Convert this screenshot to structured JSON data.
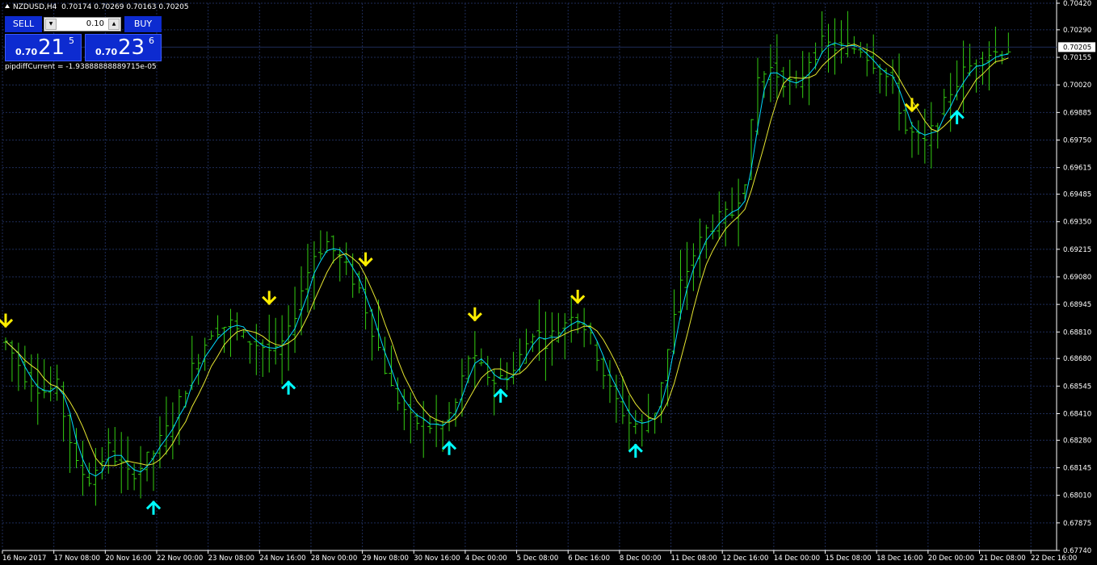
{
  "header": {
    "symbol": "NZDUSD,H4",
    "ohlc": "0.70174 0.70269 0.70163 0.70205"
  },
  "trade_panel": {
    "sell_label": "SELL",
    "buy_label": "BUY",
    "lot_value": "0.10",
    "sell_prefix": "0.70",
    "sell_big": "21",
    "sell_sup": "5",
    "buy_prefix": "0.70",
    "buy_big": "23",
    "buy_sup": "6"
  },
  "indicator_text": "pipdiffCurrent = -1.93888888889715e-05",
  "colors": {
    "background": "#000000",
    "grid": "#1e2c58",
    "bars": "#33cc11",
    "ma_fast": "#00d8ff",
    "ma_slow": "#e8e830",
    "arrow_up": "#00ffff",
    "arrow_down": "#ffee00",
    "price_tag_bg": "#ffffff",
    "button_blue": "#0d2bd0"
  },
  "chart_data": {
    "type": "line",
    "timeframe": "H4",
    "price_axis": {
      "ticks": [
        "0.70420",
        "0.70290",
        "0.70155",
        "0.70020",
        "0.69885",
        "0.69750",
        "0.69615",
        "0.69485",
        "0.69350",
        "0.69215",
        "0.69080",
        "0.68945",
        "0.68810",
        "0.68680",
        "0.68545",
        "0.68410",
        "0.68280",
        "0.68145",
        "0.68010",
        "0.67875",
        "0.67740"
      ],
      "range": [
        0.6774,
        0.7042
      ],
      "current_price": "0.70205"
    },
    "time_axis": {
      "ticks": [
        "16 Nov 2017",
        "17 Nov 08:00",
        "20 Nov 16:00",
        "22 Nov 00:00",
        "23 Nov 08:00",
        "24 Nov 16:00",
        "28 Nov 00:00",
        "29 Nov 08:00",
        "30 Nov 16:00",
        "4 Dec 00:00",
        "5 Dec 08:00",
        "6 Dec 16:00",
        "8 Dec 00:00",
        "11 Dec 08:00",
        "12 Dec 16:00",
        "14 Dec 00:00",
        "15 Dec 08:00",
        "18 Dec 16:00",
        "20 Dec 00:00",
        "21 Dec 08:00",
        "22 Dec 16:00"
      ]
    },
    "bars_per_tick": 8,
    "close_path": [
      [
        0,
        0.6876
      ],
      [
        3,
        0.686
      ],
      [
        6,
        0.6852
      ],
      [
        8,
        0.6854
      ],
      [
        11,
        0.6815
      ],
      [
        13,
        0.6809
      ],
      [
        16,
        0.6824
      ],
      [
        19,
        0.6811
      ],
      [
        21,
        0.6815
      ],
      [
        23,
        0.6822
      ],
      [
        26,
        0.6838
      ],
      [
        29,
        0.6863
      ],
      [
        32,
        0.6882
      ],
      [
        35,
        0.6885
      ],
      [
        37,
        0.6878
      ],
      [
        40,
        0.6874
      ],
      [
        42,
        0.687
      ],
      [
        44,
        0.688
      ],
      [
        46,
        0.6902
      ],
      [
        48,
        0.6919
      ],
      [
        50,
        0.6925
      ],
      [
        53,
        0.6912
      ],
      [
        55,
        0.6902
      ],
      [
        58,
        0.6873
      ],
      [
        60,
        0.6853
      ],
      [
        63,
        0.6838
      ],
      [
        66,
        0.6835
      ],
      [
        68,
        0.6835
      ],
      [
        70,
        0.6846
      ],
      [
        72,
        0.6869
      ],
      [
        74,
        0.6863
      ],
      [
        76,
        0.6857
      ],
      [
        79,
        0.6862
      ],
      [
        82,
        0.6882
      ],
      [
        84,
        0.6877
      ],
      [
        86,
        0.6882
      ],
      [
        88,
        0.6891
      ],
      [
        90,
        0.6884
      ],
      [
        92,
        0.687
      ],
      [
        94,
        0.6852
      ],
      [
        97,
        0.6837
      ],
      [
        99,
        0.6835
      ],
      [
        101,
        0.6843
      ],
      [
        103,
        0.6872
      ],
      [
        105,
        0.6904
      ],
      [
        107,
        0.6919
      ],
      [
        109,
        0.6931
      ],
      [
        111,
        0.6936
      ],
      [
        113,
        0.6939
      ],
      [
        115,
        0.6957
      ],
      [
        117,
        0.7005
      ],
      [
        119,
        0.701
      ],
      [
        121,
        0.7005
      ],
      [
        123,
        0.7
      ],
      [
        125,
        0.7015
      ],
      [
        127,
        0.7022
      ],
      [
        130,
        0.702
      ],
      [
        133,
        0.702
      ],
      [
        136,
        0.701
      ],
      [
        138,
        0.7002
      ],
      [
        140,
        0.698
      ],
      [
        143,
        0.6973
      ],
      [
        145,
        0.6985
      ],
      [
        147,
        0.6999
      ],
      [
        149,
        0.7008
      ],
      [
        151,
        0.7014
      ],
      [
        153,
        0.7018
      ],
      [
        155,
        0.7018
      ],
      [
        156,
        0.702
      ]
    ],
    "signals": [
      {
        "type": "sell",
        "bar": 0
      },
      {
        "type": "buy",
        "bar": 23
      },
      {
        "type": "sell",
        "bar": 41
      },
      {
        "type": "buy",
        "bar": 44
      },
      {
        "type": "sell",
        "bar": 56
      },
      {
        "type": "buy",
        "bar": 69
      },
      {
        "type": "sell",
        "bar": 73
      },
      {
        "type": "buy",
        "bar": 77
      },
      {
        "type": "sell",
        "bar": 89
      },
      {
        "type": "buy",
        "bar": 98
      },
      {
        "type": "sell",
        "bar": 141
      },
      {
        "type": "buy",
        "bar": 148
      }
    ]
  }
}
